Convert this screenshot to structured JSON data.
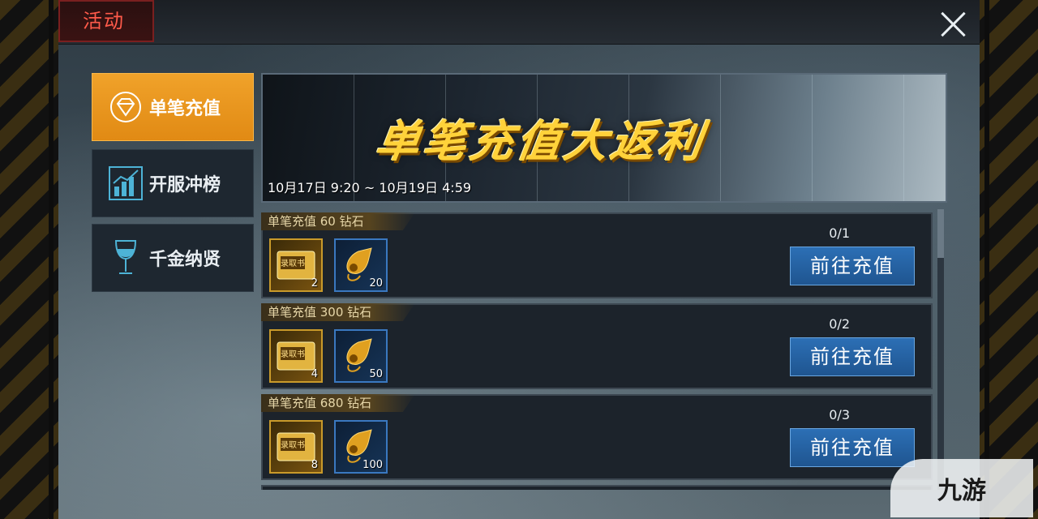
{
  "header": {
    "tab_title": "活动"
  },
  "sidebar": {
    "items": [
      {
        "label": "单笔充值",
        "icon": "diamond-icon",
        "active": true
      },
      {
        "label": "开服冲榜",
        "icon": "bar-chart-icon",
        "active": false
      },
      {
        "label": "千金纳贤",
        "icon": "wine-glass-icon",
        "active": false
      }
    ]
  },
  "banner": {
    "title": "单笔充值大返利",
    "date_range": "10月17日 9:20 ~ 10月19日 4:59"
  },
  "rewards": [
    {
      "label": "单笔充值 60 钻石",
      "progress": "0/1",
      "items": [
        {
          "name": "录取书",
          "qty": "2"
        },
        {
          "name": "whistle",
          "qty": "20"
        }
      ],
      "button": "前往充值"
    },
    {
      "label": "单笔充值 300 钻石",
      "progress": "0/2",
      "items": [
        {
          "name": "录取书",
          "qty": "4"
        },
        {
          "name": "whistle",
          "qty": "50"
        }
      ],
      "button": "前往充值"
    },
    {
      "label": "单笔充值 680 钻石",
      "progress": "0/3",
      "items": [
        {
          "name": "录取书",
          "qty": "8"
        },
        {
          "name": "whistle",
          "qty": "100"
        }
      ],
      "button": "前往充值"
    }
  ],
  "watermark": {
    "text": "九游"
  },
  "colors": {
    "accent": "#f0a22a",
    "button": "#2c6fb5",
    "title_red": "#ff5a4a",
    "banner_gold": "#ffd23a"
  }
}
